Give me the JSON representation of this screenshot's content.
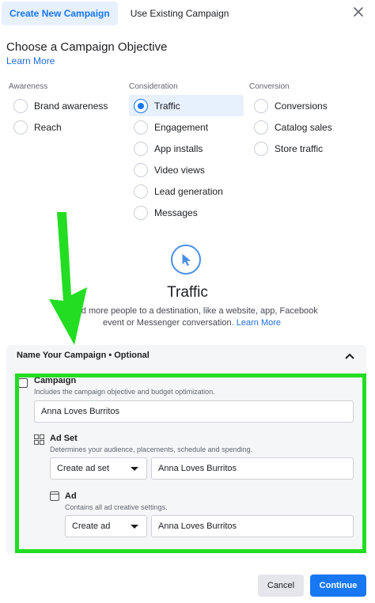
{
  "tabs": {
    "create_new": "Create New Campaign",
    "use_existing": "Use Existing Campaign"
  },
  "header": {
    "title": "Choose a Campaign Objective",
    "learn_more": "Learn More"
  },
  "objectives": {
    "awareness": {
      "heading": "Awareness",
      "options": [
        "Brand awareness",
        "Reach"
      ]
    },
    "consideration": {
      "heading": "Consideration",
      "options": [
        "Traffic",
        "Engagement",
        "App installs",
        "Video views",
        "Lead generation",
        "Messages"
      ]
    },
    "conversion": {
      "heading": "Conversion",
      "options": [
        "Conversions",
        "Catalog sales",
        "Store traffic"
      ]
    },
    "selected": "Traffic"
  },
  "info": {
    "title": "Traffic",
    "description": "Send more people to a destination, like a website, app, Facebook event or Messenger conversation.",
    "learn_more": "Learn More"
  },
  "name_panel": {
    "heading": "Name Your Campaign • Optional",
    "campaign": {
      "label": "Campaign",
      "description": "Includes the campaign objective and budget optimization.",
      "value": "Anna Loves Burritos"
    },
    "ad_set": {
      "label": "Ad Set",
      "description": "Determines your audience, placements, schedule and spending.",
      "select_value": "Create ad set",
      "value": "Anna Loves Burritos"
    },
    "ad": {
      "label": "Ad",
      "description": "Contains all ad creative settings.",
      "select_value": "Create ad",
      "value": "Anna Loves Burritos"
    }
  },
  "footer": {
    "cancel": "Cancel",
    "continue": "Continue"
  },
  "colors": {
    "accent": "#1877f2",
    "highlight": "#22dd22"
  }
}
